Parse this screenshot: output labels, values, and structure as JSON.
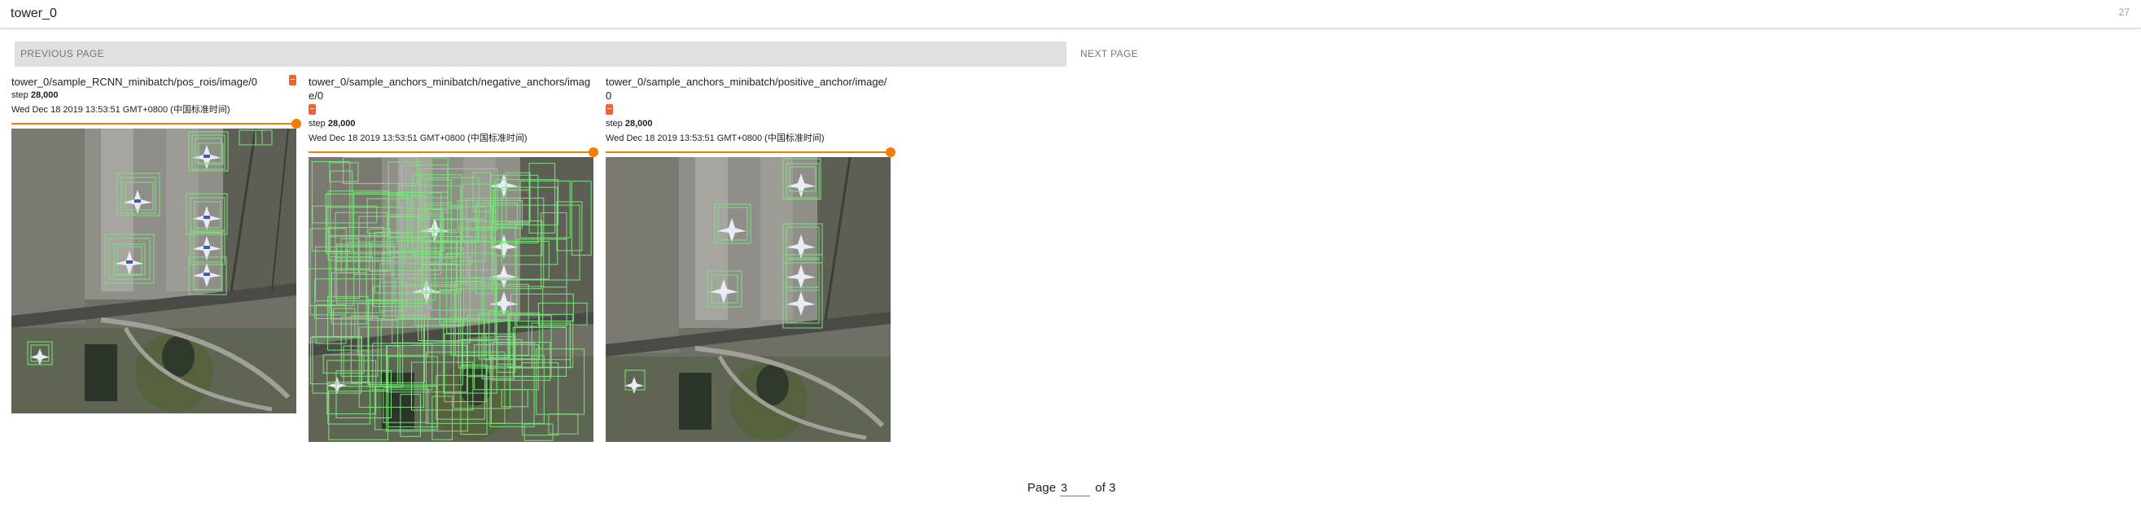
{
  "header": {
    "group_title": "tower_0",
    "count": "27"
  },
  "nav": {
    "prev_label": "PREVIOUS PAGE",
    "next_label": "NEXT PAGE"
  },
  "cards": [
    {
      "title": "tower_0/sample_RCNN_minibatch/pos_rois/image/0",
      "step_label": "step",
      "step_value": "28,000",
      "timestamp": "Wed Dec 18 2019 13:53:51 GMT+0800 (中国标准时间)",
      "slider_fraction": 1.0
    },
    {
      "title": "tower_0/sample_anchors_minibatch/negative_anchors/image/0",
      "step_label": "step",
      "step_value": "28,000",
      "timestamp": "Wed Dec 18 2019 13:53:51 GMT+0800 (中国标准时间)",
      "slider_fraction": 1.0
    },
    {
      "title": "tower_0/sample_anchors_minibatch/positive_anchor/image/0",
      "step_label": "step",
      "step_value": "28,000",
      "timestamp": "Wed Dec 18 2019 13:53:51 GMT+0800 (中国标准时间)",
      "slider_fraction": 1.0
    }
  ],
  "pager": {
    "prefix": "Page",
    "current": "3",
    "suffix": "of 3"
  },
  "colors": {
    "accent": "#f57c00",
    "expand": "#e8653a",
    "box": "#7fe07f"
  }
}
